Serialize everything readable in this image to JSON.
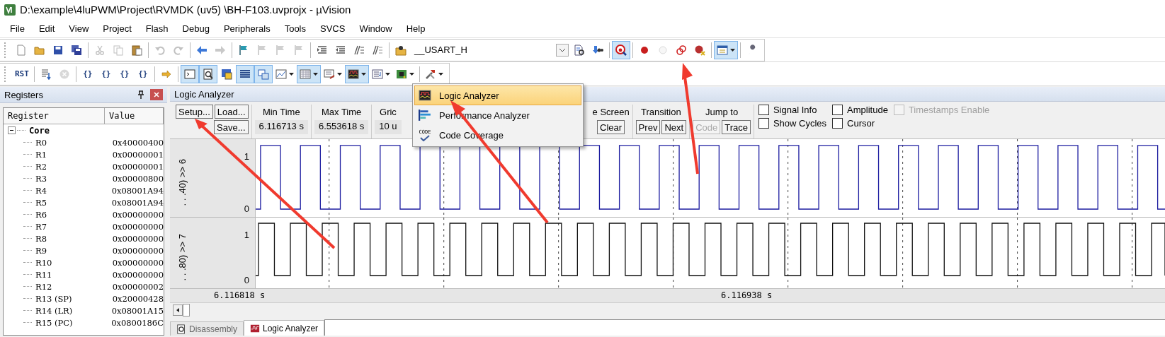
{
  "window": {
    "title": "D:\\example\\4luPWM\\Project\\RVMDK  (uv5)  \\BH-F103.uvprojx - µVision"
  },
  "menu": [
    "File",
    "Edit",
    "View",
    "Project",
    "Flash",
    "Debug",
    "Peripherals",
    "Tools",
    "SVCS",
    "Window",
    "Help"
  ],
  "toolbar_1": [
    {
      "kind": "button",
      "on": false,
      "disabled": false
    },
    {
      "kind": "button",
      "on": false,
      "disabled": false
    },
    {
      "kind": "button",
      "on": false,
      "disabled": false
    },
    {
      "kind": "button",
      "on": false,
      "disabled": false
    },
    {
      "kind": "sep"
    },
    {
      "kind": "button",
      "on": false,
      "disabled": true
    },
    {
      "kind": "button",
      "on": false,
      "disabled": true
    },
    {
      "kind": "button",
      "on": false,
      "disabled": false
    },
    {
      "kind": "sep"
    },
    {
      "kind": "button",
      "on": false,
      "disabled": true
    },
    {
      "kind": "button",
      "on": false,
      "disabled": true
    },
    {
      "kind": "sep"
    },
    {
      "kind": "button",
      "on": false,
      "disabled": false
    },
    {
      "kind": "button",
      "on": false,
      "disabled": true
    },
    {
      "kind": "sep"
    },
    {
      "kind": "button",
      "on": false,
      "disabled": false
    },
    {
      "kind": "button",
      "on": false,
      "disabled": true
    },
    {
      "kind": "button",
      "on": false,
      "disabled": true
    },
    {
      "kind": "button",
      "on": false,
      "disabled": true
    },
    {
      "kind": "sep"
    },
    {
      "kind": "button",
      "on": false,
      "disabled": false
    },
    {
      "kind": "button",
      "on": false,
      "disabled": false
    },
    {
      "kind": "button",
      "on": false,
      "disabled": false
    },
    {
      "kind": "button",
      "on": false,
      "disabled": false
    },
    {
      "kind": "sep"
    },
    {
      "kind": "button",
      "on": false,
      "disabled": false
    },
    {
      "kind": "combo",
      "value": "__USART_H"
    },
    {
      "kind": "button",
      "on": false,
      "disabled": false
    },
    {
      "kind": "button",
      "on": false,
      "disabled": false
    },
    {
      "kind": "sep"
    },
    {
      "kind": "button",
      "on": true,
      "disabled": false
    },
    {
      "kind": "sep"
    },
    {
      "kind": "button",
      "on": false,
      "disabled": false
    },
    {
      "kind": "button",
      "on": false,
      "disabled": true
    },
    {
      "kind": "button",
      "on": false,
      "disabled": false
    },
    {
      "kind": "button",
      "on": false,
      "disabled": false
    },
    {
      "kind": "sep"
    },
    {
      "kind": "button",
      "on": true,
      "disabled": false,
      "menu": true
    },
    {
      "kind": "sep"
    },
    {
      "kind": "button",
      "on": false,
      "disabled": false
    }
  ],
  "toolbar_2": [
    {
      "kind": "label",
      "label": "RST",
      "on": false
    },
    {
      "kind": "sep"
    },
    {
      "kind": "button",
      "on": false,
      "disabled": false
    },
    {
      "kind": "button",
      "on": false,
      "disabled": true
    },
    {
      "kind": "sep"
    },
    {
      "kind": "label",
      "label": "{}",
      "on": false
    },
    {
      "kind": "label",
      "label": "{}",
      "on": false
    },
    {
      "kind": "label",
      "label": "{}",
      "on": false
    },
    {
      "kind": "label",
      "label": "{}",
      "on": false
    },
    {
      "kind": "sep"
    },
    {
      "kind": "button",
      "on": false,
      "disabled": false
    },
    {
      "kind": "sep"
    },
    {
      "kind": "button",
      "on": true,
      "disabled": false
    },
    {
      "kind": "button",
      "on": true,
      "disabled": false
    },
    {
      "kind": "button",
      "on": false,
      "disabled": false
    },
    {
      "kind": "button",
      "on": true,
      "disabled": false
    },
    {
      "kind": "button",
      "on": true,
      "disabled": false
    },
    {
      "kind": "button",
      "on": false,
      "disabled": false,
      "menu": true
    },
    {
      "kind": "button",
      "on": true,
      "disabled": false,
      "menu": true
    },
    {
      "kind": "button",
      "on": false,
      "disabled": false,
      "menu": true
    },
    {
      "kind": "button",
      "on": true,
      "disabled": false,
      "menu": true
    },
    {
      "kind": "button",
      "on": false,
      "disabled": false,
      "menu": true
    },
    {
      "kind": "button",
      "on": false,
      "disabled": false,
      "menu": true
    },
    {
      "kind": "sep"
    },
    {
      "kind": "button",
      "on": false,
      "disabled": false,
      "menu": true
    }
  ],
  "registers": {
    "title": "Registers",
    "columns": [
      "Register",
      "Value"
    ],
    "tree": [
      {
        "name": "Core",
        "expanded": true,
        "children": [
          {
            "name": "R0",
            "value": "0x40000400"
          },
          {
            "name": "R1",
            "value": "0x00000001"
          },
          {
            "name": "R2",
            "value": "0x00000001"
          },
          {
            "name": "R3",
            "value": "0x00000800"
          },
          {
            "name": "R4",
            "value": "0x08001A94"
          },
          {
            "name": "R5",
            "value": "0x08001A94"
          },
          {
            "name": "R6",
            "value": "0x00000000"
          },
          {
            "name": "R7",
            "value": "0x00000000"
          },
          {
            "name": "R8",
            "value": "0x00000000"
          },
          {
            "name": "R9",
            "value": "0x00000000"
          },
          {
            "name": "R10",
            "value": "0x00000000"
          },
          {
            "name": "R11",
            "value": "0x00000000"
          },
          {
            "name": "R12",
            "value": "0x00000002"
          },
          {
            "name": "R13 (SP)",
            "value": "0x20000428"
          },
          {
            "name": "R14 (LR)",
            "value": "0x08001A15"
          },
          {
            "name": "R15 (PC)",
            "value": "0x0800186C"
          }
        ]
      }
    ]
  },
  "analyzer": {
    "title": "Logic Analyzer",
    "setup": "Setup...",
    "load": "Load...",
    "save": "Save...",
    "time_fields": [
      {
        "label": "Min Time",
        "value": "6.116713 s"
      },
      {
        "label": "Max Time",
        "value": "6.553618 s"
      },
      {
        "label": "Gric",
        "value": "10 u"
      }
    ],
    "update": {
      "label": "e Screen",
      "button": "Clear"
    },
    "transition": {
      "label": "Transition",
      "buttons": [
        "Prev",
        "Next"
      ]
    },
    "jump": {
      "label": "Jump to",
      "buttons": [
        {
          "label": "Code",
          "disabled": true
        },
        {
          "label": "Trace",
          "disabled": false
        }
      ]
    },
    "checkboxes": [
      {
        "label": "Signal Info",
        "checked": false,
        "disabled": false
      },
      {
        "label": "Amplitude",
        "checked": false,
        "disabled": false
      },
      {
        "label": "Timestamps Enable",
        "checked": false,
        "disabled": true
      },
      {
        "label": "Show Cycles",
        "checked": false,
        "disabled": false
      },
      {
        "label": "Cursor",
        "checked": false,
        "disabled": false
      }
    ],
    "signals": [
      {
        "name": ". . .40) >> 6",
        "max": "1",
        "min": "0",
        "color": "#1c1ca0"
      },
      {
        "name": ". . .80) >> 7",
        "max": "1",
        "min": "0",
        "color": "#111111"
      }
    ],
    "time_labels": [
      "6.116818 s",
      "6.116938 s"
    ]
  },
  "popup_menu": [
    {
      "label": "Logic Analyzer",
      "selected": true
    },
    {
      "label": "Performance Analyzer",
      "selected": false
    },
    {
      "label": "Code Coverage",
      "selected": false,
      "badge": "CODE"
    }
  ],
  "bottom_tabs": [
    {
      "label": "Disassembly",
      "selected": false
    },
    {
      "label": "Logic Analyzer",
      "selected": true
    }
  ]
}
